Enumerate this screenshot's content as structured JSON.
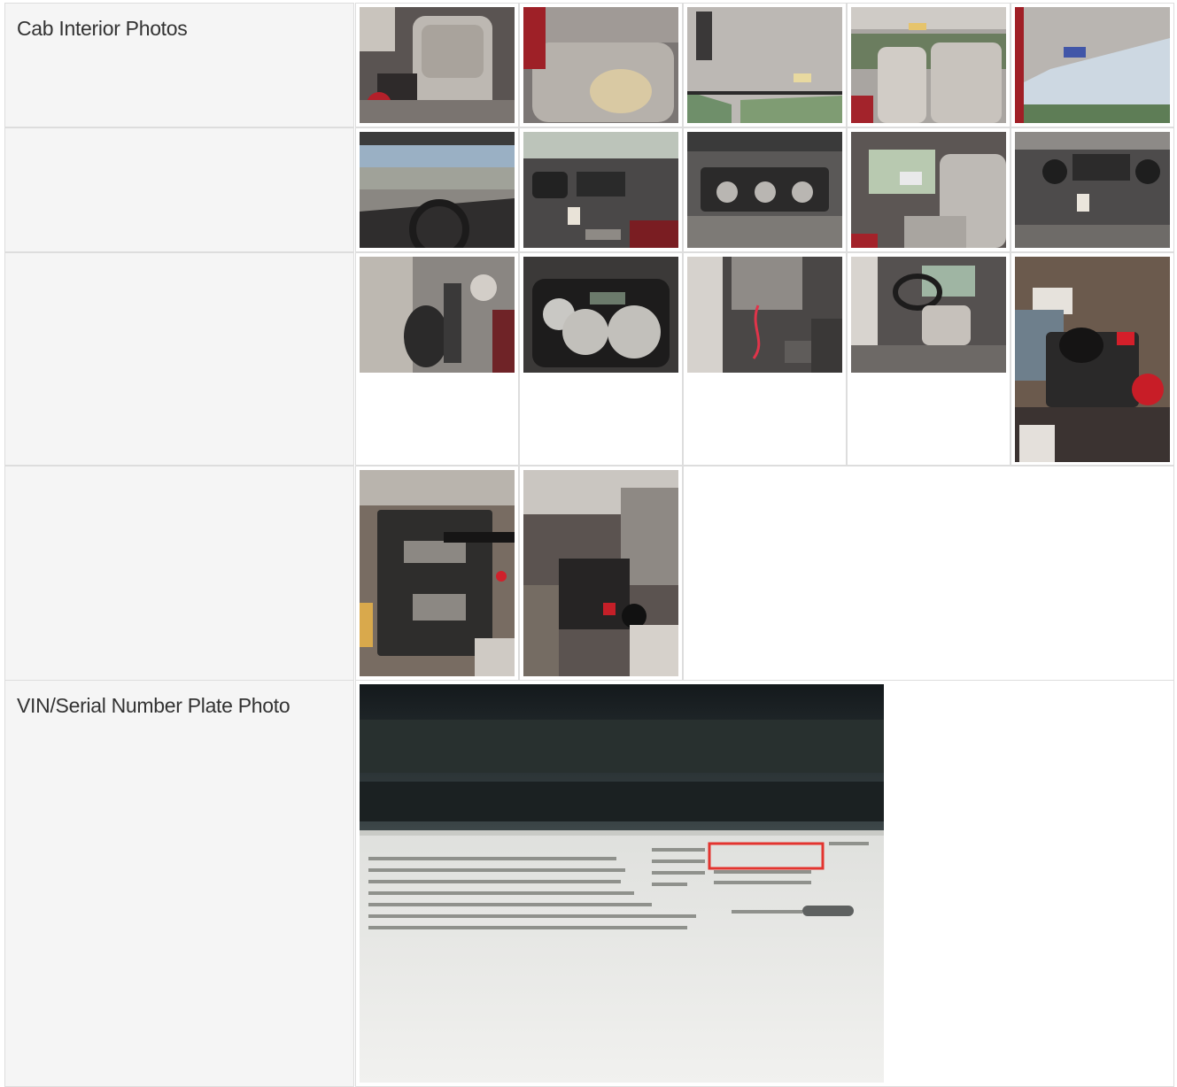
{
  "rows": [
    {
      "label": "Cab Interior Photos"
    },
    {
      "label": ""
    },
    {
      "label": ""
    },
    {
      "label": ""
    },
    {
      "label": "VIN/Serial Number Plate Photo"
    }
  ],
  "photos": {
    "cab_interior": [
      "seat-photo",
      "torn-seat-photo",
      "headliner-photo",
      "seat-rear-photo",
      "windshield-photo",
      "dashboard-photo",
      "dash-vents-photo",
      "climate-controls-photo",
      "passenger-door-photo",
      "radio-console-photo",
      "dash-switches-photo",
      "gauge-cluster-photo",
      "steering-column-photo",
      "driver-seat-photo",
      "control-panel-photo",
      "console-levers-photo",
      "shifter-photo"
    ],
    "vin_plate": "vin-plate-photo"
  },
  "colors": {
    "label_background": "#f5f5f5",
    "border": "#dddddd",
    "text": "#333333",
    "vin_highlight": "#e3342f"
  }
}
